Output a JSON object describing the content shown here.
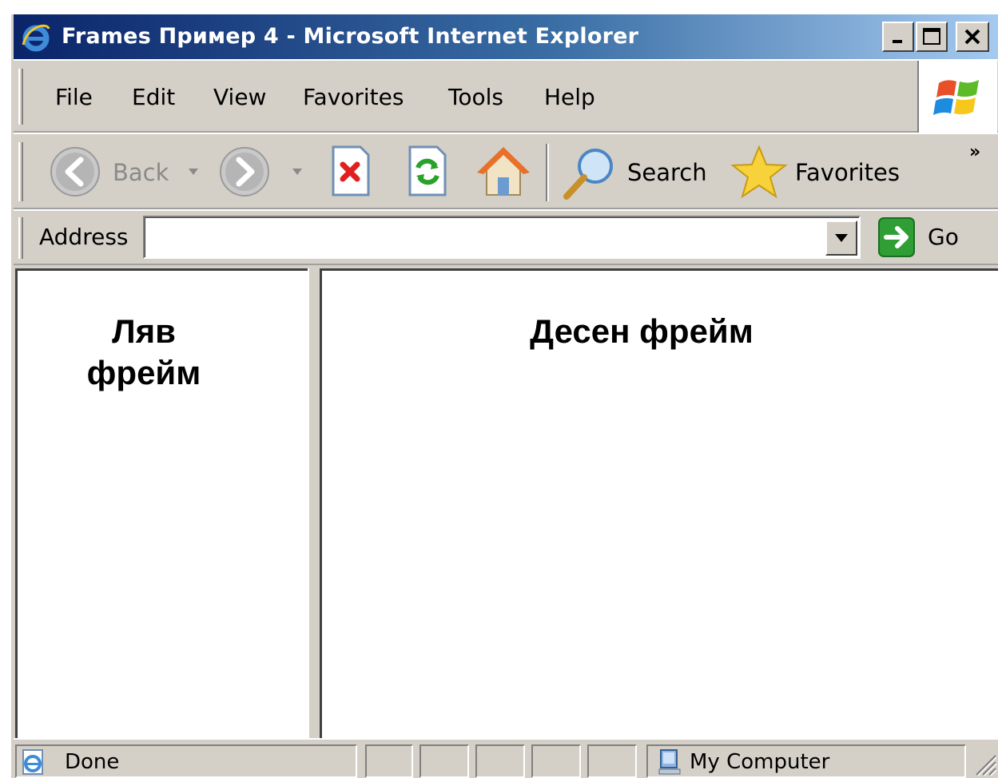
{
  "window": {
    "title": "Frames Пример 4 - Microsoft Internet Explorer"
  },
  "menu": {
    "items": [
      "File",
      "Edit",
      "View",
      "Favorites",
      "Tools",
      "Help"
    ]
  },
  "toolbar": {
    "back_label": "Back",
    "search_label": "Search",
    "favorites_label": "Favorites",
    "more_label": "»"
  },
  "address": {
    "label": "Address",
    "value": "",
    "go_label": "Go"
  },
  "frames": {
    "left_line1": "Ляв",
    "left_line2": "фрейм",
    "right_heading": "Десен фрейм"
  },
  "status": {
    "text": "Done",
    "zone": "My Computer"
  },
  "colors": {
    "titlebar_start": "#0a246a",
    "titlebar_end": "#a6caf0",
    "chrome": "#d4d0c8"
  }
}
